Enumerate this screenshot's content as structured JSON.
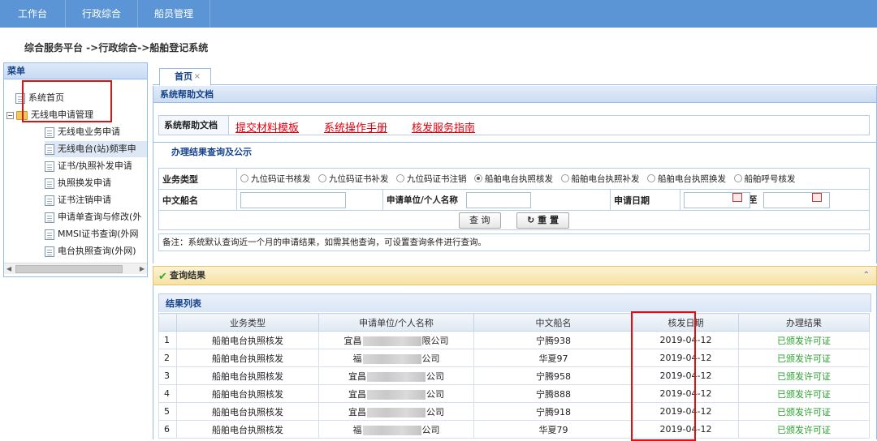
{
  "topnav": {
    "items": [
      "工作台",
      "行政综合",
      "船员管理"
    ]
  },
  "breadcrumb": "综合服务平台 ->行政综合->船舶登记系统",
  "sidebar": {
    "title": "菜单",
    "items": [
      {
        "label": "系统首页",
        "icon": "document-icon"
      },
      {
        "label": "无线电申请管理",
        "icon": "folder-icon",
        "expanded": true
      },
      {
        "label": "无线电业务申请",
        "icon": "document-icon"
      },
      {
        "label": "无线电台(站)频率申",
        "icon": "document-icon",
        "selected": true
      },
      {
        "label": "证书/执照补发申请",
        "icon": "document-icon"
      },
      {
        "label": "执照换发申请",
        "icon": "document-icon"
      },
      {
        "label": "证书注销申请",
        "icon": "document-icon"
      },
      {
        "label": "申请单查询与修改(外",
        "icon": "document-icon"
      },
      {
        "label": "MMSI证书查询(外网",
        "icon": "document-icon"
      },
      {
        "label": "电台执照查询(外网)",
        "icon": "document-icon"
      }
    ]
  },
  "tabs": [
    {
      "label": "首页",
      "close": "×"
    }
  ],
  "help": {
    "panel_title": "系统帮助文档",
    "row_label": "系统帮助文档",
    "links": [
      "提交材料模板",
      "系统操作手册",
      "核发服务指南"
    ]
  },
  "query": {
    "panel_title": "办理结果查询及公示",
    "type_label": "业务类型",
    "types": [
      "九位码证书核发",
      "九位码证书补发",
      "九位码证书注销",
      "船舶电台执照核发",
      "船舶电台执照补发",
      "船舶电台执照换发",
      "船舶呼号核发"
    ],
    "selected_type": "船舶电台执照核发",
    "ship_name_label": "中文船名",
    "applicant_label": "申请单位/个人名称",
    "date_label": "申请日期",
    "date_to": "至",
    "search_button": "查 询",
    "reset_button": "重 置",
    "note": "备注：系统默认查询近一个月的申请结果，如需其他查询，可设置查询条件进行查询。"
  },
  "results": {
    "bar_title": "查询结果",
    "list_title": "结果列表",
    "columns": [
      "业务类型",
      "申请单位/个人名称",
      "中文船名",
      "核发日期",
      "办理结果"
    ],
    "rows": [
      {
        "n": "1",
        "type": "船舶电台执照核发",
        "applicant_pre": "宜昌",
        "applicant_suf": "限公司",
        "ship": "宁腾938",
        "date": "2019-04-12",
        "result": "已颁发许可证"
      },
      {
        "n": "2",
        "type": "船舶电台执照核发",
        "applicant_pre": "福",
        "applicant_suf": "公司",
        "ship": "华夏97",
        "date": "2019-04-12",
        "result": "已颁发许可证"
      },
      {
        "n": "3",
        "type": "船舶电台执照核发",
        "applicant_pre": "宜昌",
        "applicant_suf": "公司",
        "ship": "宁腾958",
        "date": "2019-04-12",
        "result": "已颁发许可证"
      },
      {
        "n": "4",
        "type": "船舶电台执照核发",
        "applicant_pre": "宜昌",
        "applicant_suf": "公司",
        "ship": "宁腾888",
        "date": "2019-04-12",
        "result": "已颁发许可证"
      },
      {
        "n": "5",
        "type": "船舶电台执照核发",
        "applicant_pre": "宜昌",
        "applicant_suf": "公司",
        "ship": "宁腾918",
        "date": "2019-04-12",
        "result": "已颁发许可证"
      },
      {
        "n": "6",
        "type": "船舶电台执照核发",
        "applicant_pre": "福",
        "applicant_suf": "公司",
        "ship": "华夏79",
        "date": "2019-04-12",
        "result": "已颁发许可证"
      }
    ]
  },
  "colors": {
    "nav": "#5b95d5",
    "link_red": "#e0000e",
    "ok_green": "#29a12e",
    "highlight_box": "#e01010"
  }
}
